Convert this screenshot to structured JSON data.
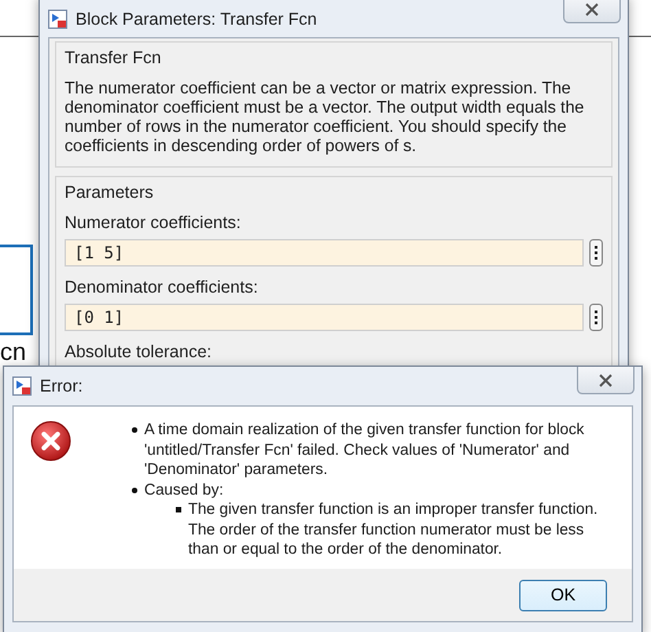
{
  "canvas": {
    "block_label": "cn"
  },
  "parameters_dialog": {
    "title": "Block Parameters: Transfer Fcn",
    "description_group": {
      "title": "Transfer Fcn",
      "text": "The numerator coefficient can be a vector or matrix expression. The denominator coefficient must be a vector. The output width equals the number of rows in the numerator coefficient. You should specify the coefficients in descending order of powers of s."
    },
    "parameters_group": {
      "title": "Parameters",
      "fields": [
        {
          "label": "Numerator coefficients:",
          "value": "[1 5]"
        },
        {
          "label": "Denominator coefficients:",
          "value": "[0 1]"
        },
        {
          "label": "Absolute tolerance:"
        }
      ]
    }
  },
  "error_dialog": {
    "title": "Error:",
    "messages": [
      {
        "text": "A time domain realization of the given transfer function for block 'untitled/Transfer Fcn' failed. Check values of 'Numerator' and 'Denominator' parameters."
      },
      {
        "text": "Caused by:",
        "children": [
          {
            "text": "The given transfer function is an improper transfer function. The order of the transfer function numerator must be less than or equal to the order of the denominator."
          }
        ]
      }
    ],
    "buttons": [
      "OK"
    ]
  }
}
